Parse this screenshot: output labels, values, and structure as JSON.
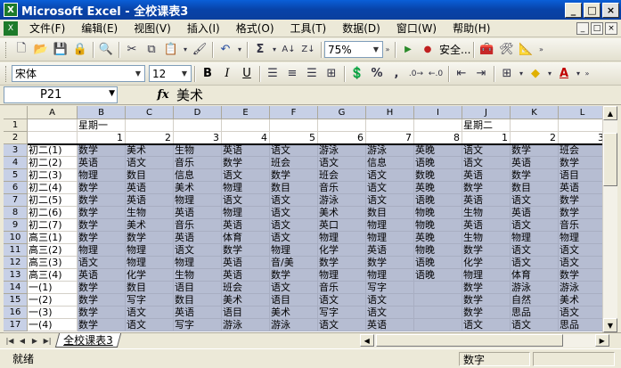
{
  "window": {
    "title": "Microsoft Excel - 全校课表3",
    "minimize": "_",
    "maximize": "□",
    "close": "×"
  },
  "menu": {
    "items": [
      "文件(F)",
      "编辑(E)",
      "视图(V)",
      "插入(I)",
      "格式(O)",
      "工具(T)",
      "数据(D)",
      "窗口(W)",
      "帮助(H)"
    ],
    "doc_controls": [
      "_",
      "□",
      "×"
    ]
  },
  "toolbar1": {
    "zoom": "75%",
    "security": "安全..."
  },
  "toolbar2": {
    "font": "宋体",
    "size": "12",
    "bold": "B",
    "italic": "I",
    "underline": "U",
    "percent": "%",
    "comma": ","
  },
  "formula_bar": {
    "cell_ref": "P21",
    "fx": "fx",
    "value": "美术"
  },
  "columns": [
    "A",
    "B",
    "C",
    "D",
    "E",
    "F",
    "G",
    "H",
    "I",
    "J",
    "K",
    "L"
  ],
  "rows": [
    "1",
    "2",
    "3",
    "4",
    "5",
    "6",
    "7",
    "8",
    "9",
    "10",
    "11",
    "12",
    "13",
    "14",
    "15",
    "16",
    "17"
  ],
  "sheet": {
    "row1": [
      "",
      "星期一",
      "",
      "",
      "",
      "",
      "",
      "",
      "",
      "星期二",
      "",
      ""
    ],
    "row2": [
      "",
      "1",
      "2",
      "3",
      "4",
      "5",
      "6",
      "7",
      "8",
      "1",
      "2",
      "3"
    ],
    "classes": [
      "初二(1)",
      "初二(2)",
      "初二(3)",
      "初二(4)",
      "初二(5)",
      "初二(6)",
      "初二(7)",
      "高三(1)",
      "高三(2)",
      "高三(3)",
      "高三(4)",
      "一(1)",
      "一(2)",
      "一(3)",
      "一(4)"
    ],
    "schedule": [
      [
        "数学",
        "美术",
        "生物",
        "英语",
        "语文",
        "游泳",
        "游泳",
        "英晚",
        "语文",
        "数学",
        "班会"
      ],
      [
        "英语",
        "语文",
        "音乐",
        "数学",
        "班会",
        "语文",
        "信息",
        "语晚",
        "语文",
        "英语",
        "数学"
      ],
      [
        "物理",
        "数目",
        "信息",
        "语文",
        "数学",
        "班会",
        "语文",
        "数晚",
        "英语",
        "数学",
        "语目"
      ],
      [
        "数学",
        "英语",
        "美术",
        "物理",
        "数目",
        "音乐",
        "语文",
        "英晚",
        "数学",
        "数目",
        "英语"
      ],
      [
        "数学",
        "英语",
        "物理",
        "语文",
        "语文",
        "游泳",
        "语文",
        "语晚",
        "英语",
        "语文",
        "数学"
      ],
      [
        "数学",
        "生物",
        "英语",
        "物理",
        "语文",
        "美术",
        "数目",
        "物晚",
        "生物",
        "英语",
        "数学"
      ],
      [
        "数学",
        "美术",
        "音乐",
        "英语",
        "语文",
        "英口",
        "物理",
        "物晚",
        "英语",
        "语文",
        "音乐"
      ],
      [
        "数学",
        "数学",
        "英语",
        "体育",
        "语文",
        "物理",
        "物理",
        "英晚",
        "生物",
        "物理",
        "物理"
      ],
      [
        "物理",
        "物理",
        "语文",
        "数学",
        "物理",
        "化学",
        "英语",
        "物晚",
        "数学",
        "语文",
        "语文"
      ],
      [
        "语文",
        "物理",
        "物理",
        "英语",
        "音/美",
        "数学",
        "数学",
        "语晚",
        "化学",
        "语文",
        "语文"
      ],
      [
        "英语",
        "化学",
        "生物",
        "英语",
        "数学",
        "物理",
        "物理",
        "语晚",
        "物理",
        "体育",
        "数学"
      ],
      [
        "数学",
        "数目",
        "语目",
        "班会",
        "语文",
        "音乐",
        "写字",
        "",
        "数学",
        "游泳",
        "游泳"
      ],
      [
        "数学",
        "写字",
        "数目",
        "美术",
        "语目",
        "语文",
        "语文",
        "",
        "数学",
        "自然",
        "美术"
      ],
      [
        "数学",
        "语文",
        "英语",
        "语目",
        "美术",
        "写字",
        "语文",
        "",
        "数学",
        "思品",
        "语文"
      ],
      [
        "数学",
        "语文",
        "写字",
        "游泳",
        "游泳",
        "语文",
        "英语",
        "",
        "语文",
        "语文",
        "思品"
      ]
    ]
  },
  "sheet_tab": "全校课表3",
  "status": {
    "ready": "就绪",
    "sum_label": "数字"
  }
}
